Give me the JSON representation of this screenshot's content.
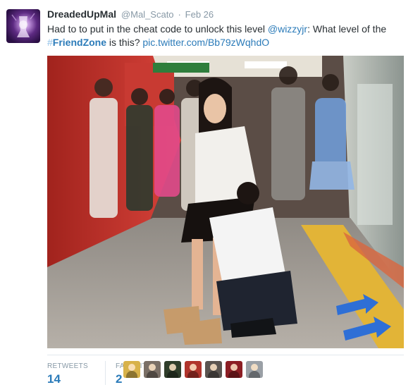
{
  "tweet": {
    "fullname": "DreadedUpMal",
    "username": "@Mal_Scato",
    "separator": "·",
    "time": "Feb 26",
    "text_part1": "Had to to put in the cheat code to unlock this level ",
    "mention": "@wizzyjr",
    "text_part2": ": What level of the ",
    "hashtag_symbol": "#",
    "hashtag_word": "FriendZone",
    "text_part3": " is this? ",
    "pic_link": "pic.twitter.com/Bb79zWqhdO"
  },
  "stats": {
    "retweets_label": "RETWEETS",
    "retweets_count": "14",
    "favorites_label": "FAVORITES",
    "favorites_count": "2"
  },
  "favoriters": [
    {
      "icon": "avatar-icon",
      "color": "#d8b24a"
    },
    {
      "icon": "avatar-icon",
      "color": "#7a6f66"
    },
    {
      "icon": "avatar-icon",
      "color": "#2f3d2a"
    },
    {
      "icon": "avatar-icon",
      "color": "#b0342c"
    },
    {
      "icon": "avatar-icon",
      "color": "#5a5450"
    },
    {
      "icon": "avatar-icon",
      "color": "#8c1e24"
    },
    {
      "icon": "avatar-icon",
      "color": "#9aa0a6"
    }
  ],
  "colors": {
    "link": "#2b7bb9",
    "muted": "#8899a6",
    "text": "#292f33",
    "hashtag_symbol": "#8ec0e8"
  }
}
